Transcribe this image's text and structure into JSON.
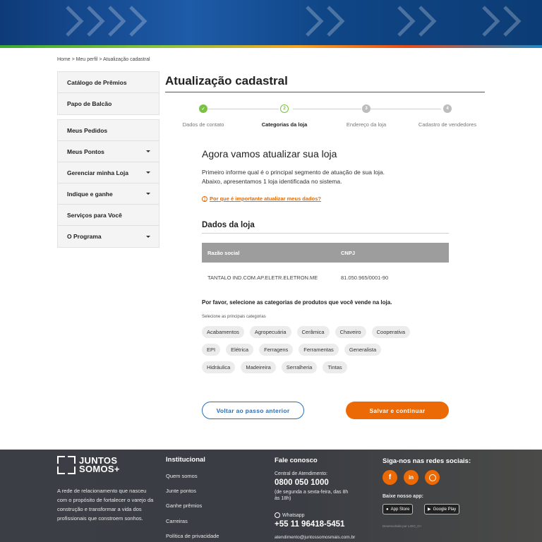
{
  "breadcrumb": "Home > Meu perfil > Atualização cadastral",
  "sidebar": {
    "group1": [
      {
        "label": "Catálogo de Prêmios",
        "expandable": false
      },
      {
        "label": "Papo de Balcão",
        "expandable": false
      }
    ],
    "group2": [
      {
        "label": "Meus Pedidos",
        "expandable": false
      },
      {
        "label": "Meus Pontos",
        "expandable": true
      },
      {
        "label": "Gerenciar minha Loja",
        "expandable": true
      },
      {
        "label": "Indique e ganhe",
        "expandable": true
      },
      {
        "label": "Serviços para Você",
        "expandable": false
      },
      {
        "label": "O Programa",
        "expandable": true
      }
    ]
  },
  "page": {
    "title": "Atualização cadastral",
    "steps": [
      {
        "number": "✓",
        "label": "Dados de contato",
        "state": "done"
      },
      {
        "number": "2",
        "label": "Categorias da loja",
        "state": "current"
      },
      {
        "number": "3",
        "label": "Endereço da loja",
        "state": "pending"
      },
      {
        "number": "4",
        "label": "Cadastro de vendedores",
        "state": "pending"
      }
    ],
    "heading": "Agora vamos atualizar sua loja",
    "intro_line1": "Primeiro informe qual é o principal segmento de atuação de sua loja.",
    "intro_line2": "Abaixo, apresentamos 1 loja identificada no sistema.",
    "why_link": "Por que é importante atualizar meus dados?",
    "section_title": "Dados da loja",
    "table": {
      "headers": [
        "Razão social",
        "CNPJ"
      ],
      "rows": [
        [
          "TANTALO IND.COM.AP.ELETR.ELETRON.ME",
          "81.050.965/0001-90"
        ]
      ]
    },
    "categories_prompt": "Por favor, selecione as categorias de produtos que você vende na loja.",
    "categories_sub": "Selecione as principais categorias",
    "categories": [
      [
        "Acabamentos",
        "Agropecuária",
        "Cerâmica",
        "Chaveiro",
        "Cooperativa"
      ],
      [
        "EPI",
        "Elétrica",
        "Ferragens",
        "Ferramentas",
        "Generalista"
      ],
      [
        "Hidráulica",
        "Madeireira",
        "Serralheria",
        "Tintas"
      ]
    ],
    "back_label": "Voltar ao passo anterior",
    "save_label": "Salvar e continuar"
  },
  "footer": {
    "logo_line1": "JUNTOS",
    "logo_line2": "SOMOS+",
    "about": "A rede de relacionamento que nasceu com o propósito de fortalecer o varejo da construção e transformar a vida dos profissionais que constroem sonhos.",
    "institutional_title": "Institucional",
    "institutional_links": [
      "Quem somos",
      "Junte pontos",
      "Ganhe prêmios",
      "Carreiras",
      "Política de privacidade"
    ],
    "contact_title": "Fale conosco",
    "center_label": "Central de Atendimento:",
    "center_phone": "0800 050 1000",
    "center_hours": "(de segunda a sexta-feira, das 8h às 18h)",
    "whatsapp_label": "Whatsapp",
    "whatsapp_phone": "+55 11 96418-5451",
    "email": "atendimento@juntossomosmais.com.br",
    "social_title": "Siga-nos nas redes sociais:",
    "app_title": "Baixe nosso app:",
    "app_store": "App Store",
    "google_play": "Google Play",
    "credit": "Desenvolvido por LIGO_O+"
  },
  "colors": {
    "accent": "#ec6a06",
    "blue": "#2a6cb5",
    "success": "#7cc242",
    "footer_bg": "#3b3e44"
  }
}
